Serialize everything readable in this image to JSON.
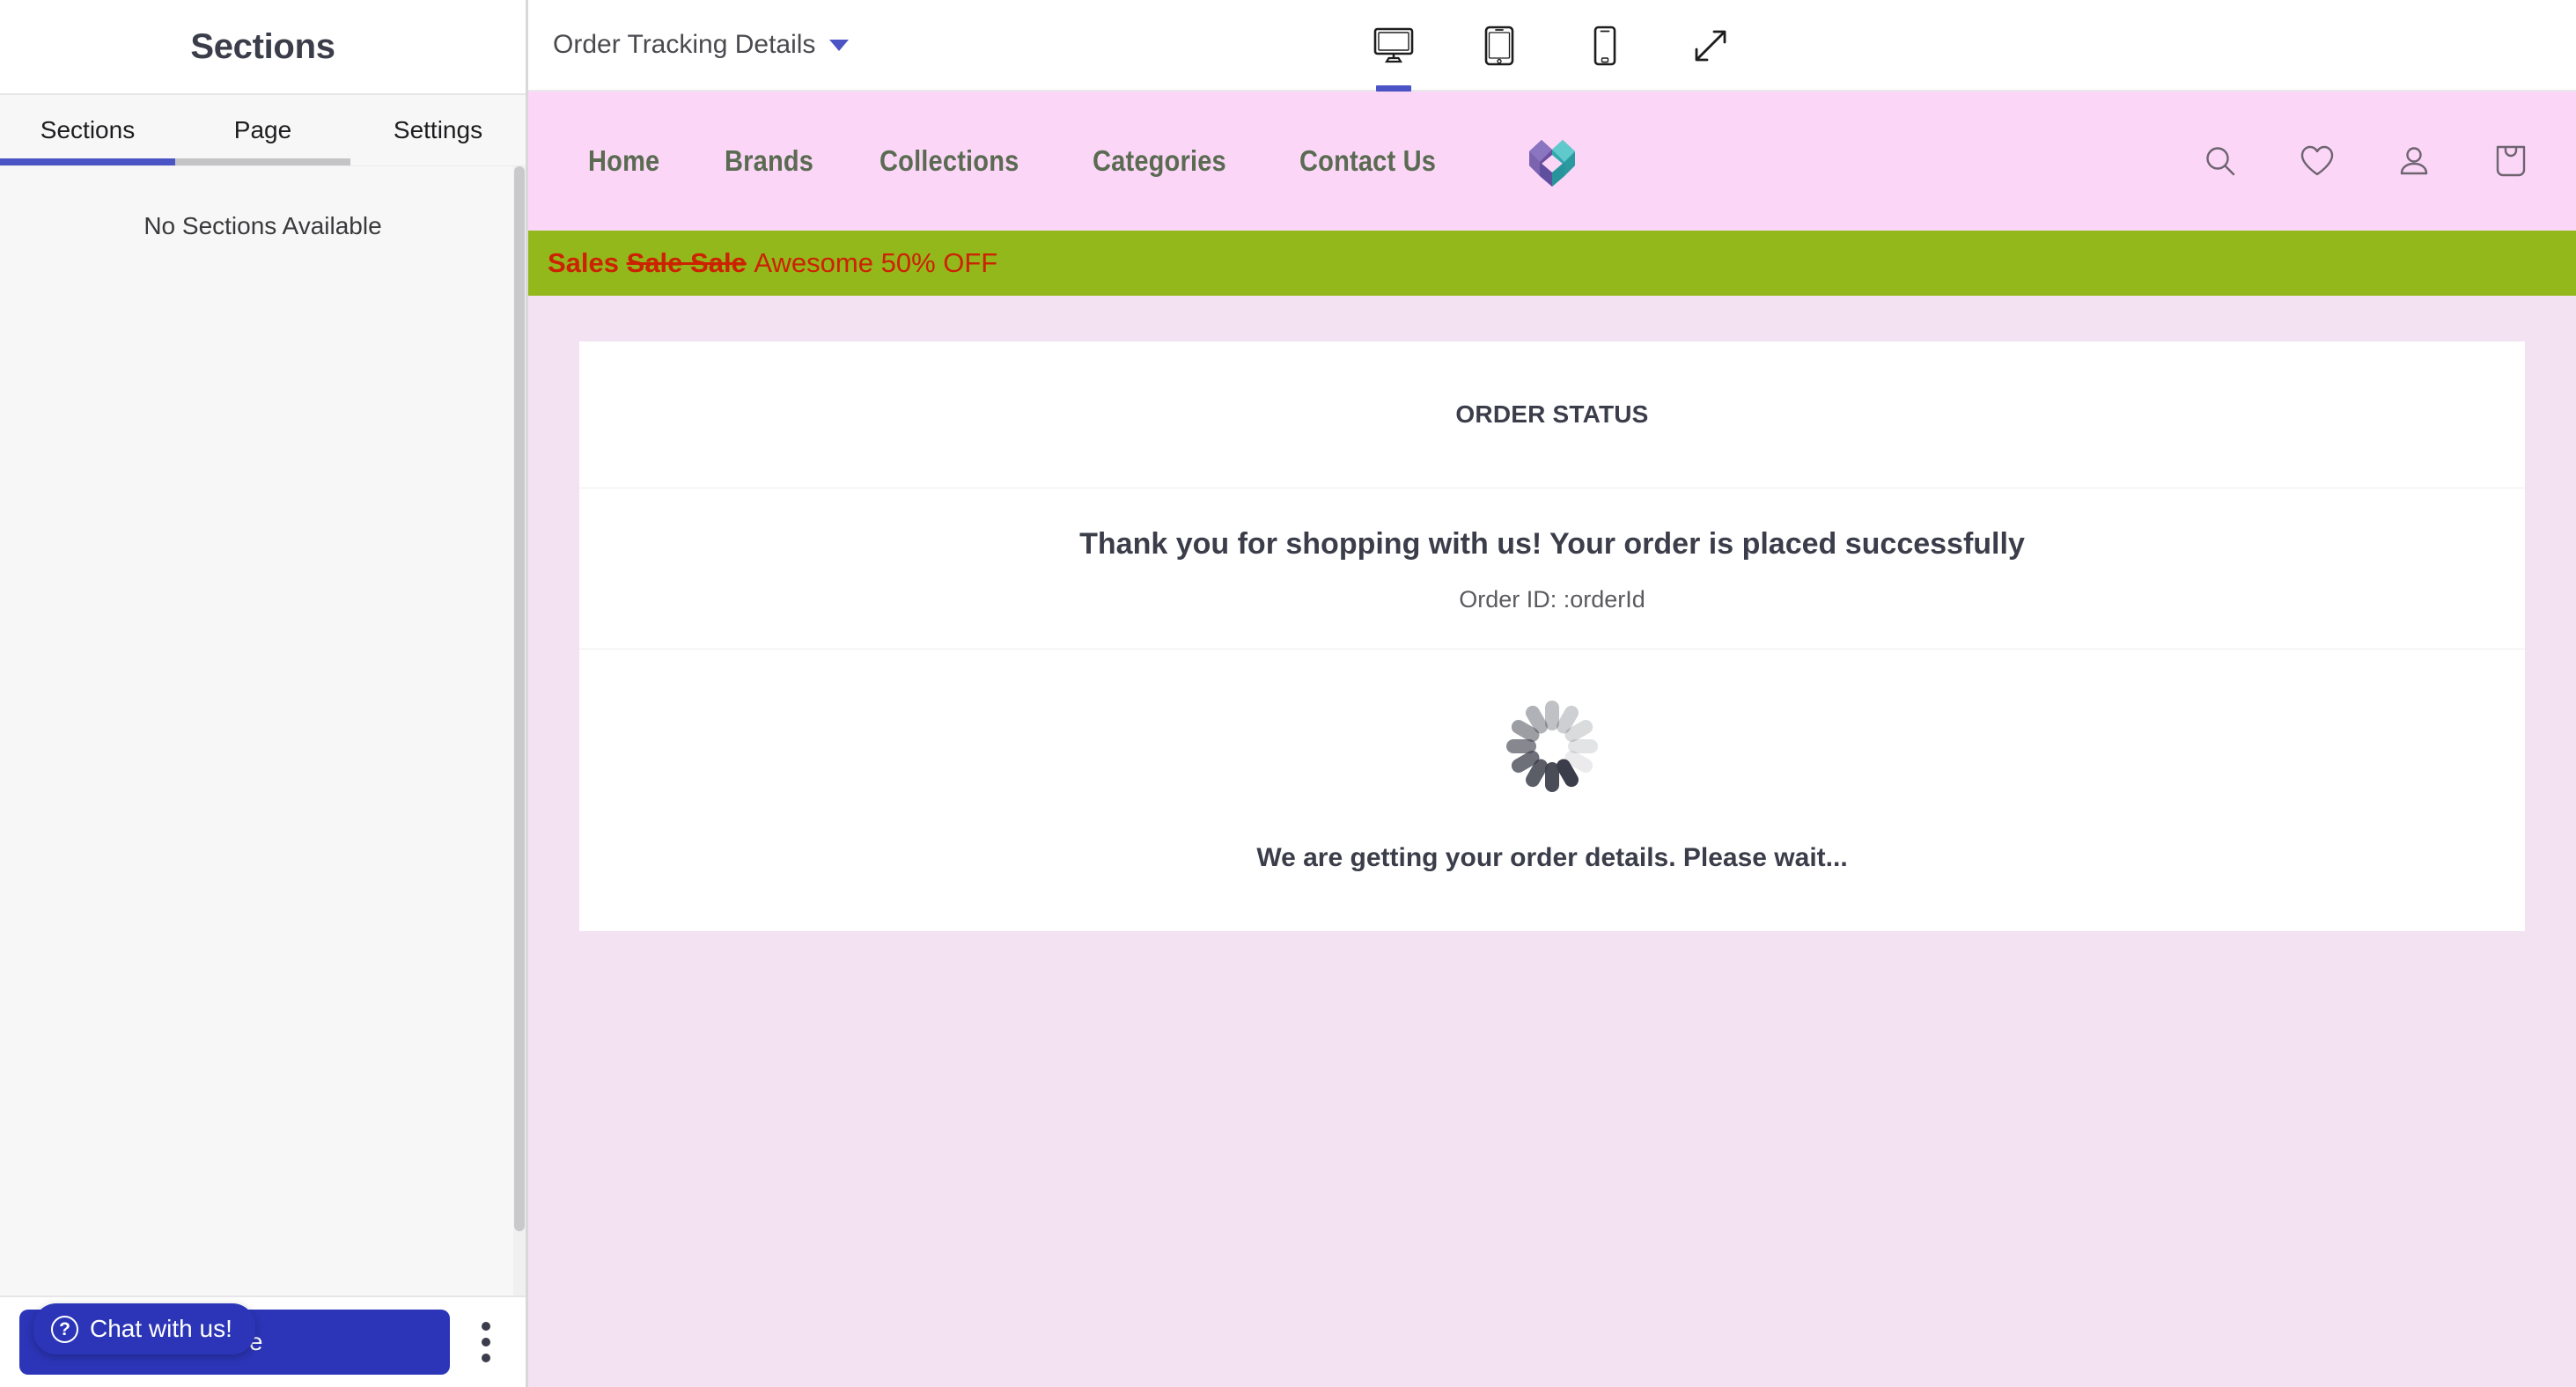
{
  "sidebar": {
    "title": "Sections",
    "tabs": [
      {
        "label": "Sections",
        "state": "active"
      },
      {
        "label": "Page",
        "state": "inactive"
      },
      {
        "label": "Settings",
        "state": "idle"
      }
    ],
    "empty_message": "No Sections Available",
    "footer": {
      "primary_button_label": "Save",
      "kebab_icon": "more-vertical-icon"
    },
    "chat_widget": {
      "label": "Chat with us!",
      "icon": "question-circle-icon",
      "color": "#2c35b8"
    },
    "accent_color": "#4a54c4"
  },
  "topbar": {
    "page_selector_label": "Order Tracking Details",
    "caret_icon": "chevron-down-icon",
    "devices": [
      {
        "name": "desktop-icon",
        "active": true
      },
      {
        "name": "tablet-icon",
        "active": false
      },
      {
        "name": "mobile-icon",
        "active": false
      },
      {
        "name": "fullscreen-icon",
        "active": false
      }
    ]
  },
  "preview": {
    "background_color": "#f3e2f1",
    "storefront_nav": {
      "background_color": "#fbd6f7",
      "link_color": "#5a6b52",
      "links": [
        {
          "label": "Home"
        },
        {
          "label": "Brands"
        },
        {
          "label": "Collections"
        },
        {
          "label": "Categories"
        },
        {
          "label": "Contact Us"
        }
      ],
      "logo": "heart-logo-icon",
      "action_icons": [
        {
          "name": "search-icon"
        },
        {
          "name": "wishlist-heart-icon"
        },
        {
          "name": "user-account-icon"
        },
        {
          "name": "shopping-bag-icon"
        }
      ]
    },
    "sale_strip": {
      "background_color": "#93b81b",
      "text_color": "#cc2200",
      "bold_text": "Sales",
      "strikethrough_text": "Sale Sale",
      "plain_text": "Awesome 50% OFF"
    },
    "order_card": {
      "heading": "ORDER STATUS",
      "thank_you": "Thank you for shopping with us! Your order is placed successfully",
      "order_id_label": "Order ID: :orderId",
      "spinner": "loading-spinner-icon",
      "waiting_message": "We are getting your order details. Please wait..."
    }
  }
}
